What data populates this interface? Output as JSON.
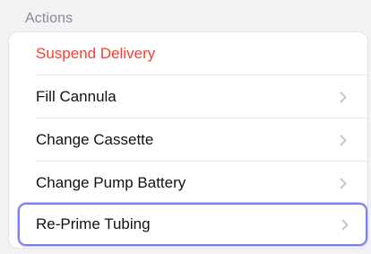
{
  "section": {
    "header": "Actions"
  },
  "actions": [
    {
      "label": "Suspend Delivery",
      "style": "destructive",
      "chevron": false
    },
    {
      "label": "Fill Cannula",
      "style": "normal",
      "chevron": true
    },
    {
      "label": "Change Cassette",
      "style": "normal",
      "chevron": true
    },
    {
      "label": "Change Pump Battery",
      "style": "normal",
      "chevron": true
    },
    {
      "label": "Re-Prime Tubing",
      "style": "selected",
      "chevron": true
    }
  ],
  "colors": {
    "destructive": "#ff3b30",
    "selection_border": "#7b7ff0",
    "chevron": "#c7c7cc"
  },
  "icons": {
    "disclosure": "chevron-right-icon"
  }
}
